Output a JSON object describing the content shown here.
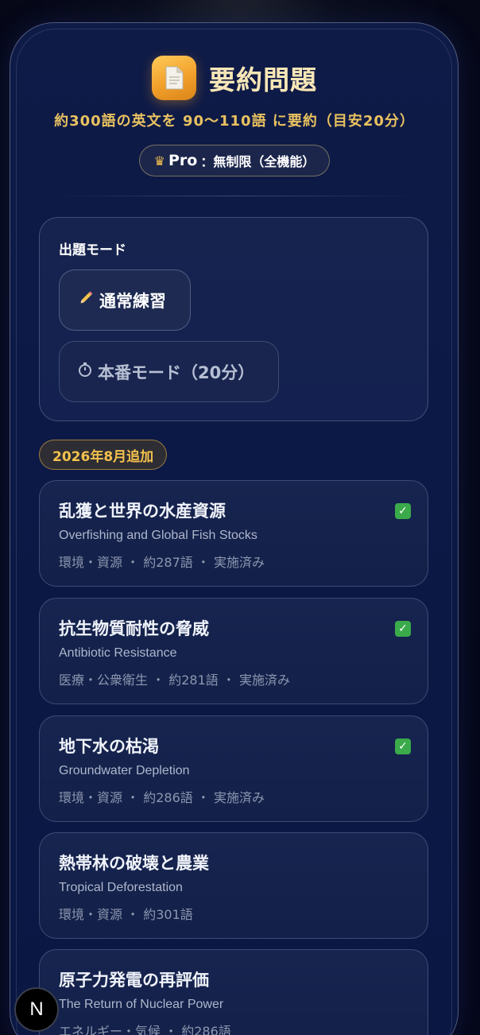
{
  "header": {
    "title": "要約問題",
    "subtitle": "約300語の英文を 90〜110語 に要約（目安20分）",
    "pro_label": "Pro",
    "pro_detail": "：無制限（全機能）"
  },
  "mode": {
    "label": "出題モード",
    "normal": "通常練習",
    "exam": "本番モード（20分）"
  },
  "added_badge": "2026年8月追加",
  "topics": [
    {
      "title": "乱獲と世界の水産資源",
      "en": "Overfishing and Global Fish Stocks",
      "category": "環境・資源",
      "words": "約287語",
      "status": "実施済み",
      "done": true
    },
    {
      "title": "抗生物質耐性の脅威",
      "en": "Antibiotic Resistance",
      "category": "医療・公衆衛生",
      "words": "約281語",
      "status": "実施済み",
      "done": true
    },
    {
      "title": "地下水の枯渇",
      "en": "Groundwater Depletion",
      "category": "環境・資源",
      "words": "約286語",
      "status": "実施済み",
      "done": true
    },
    {
      "title": "熱帯林の破壊と農業",
      "en": "Tropical Deforestation",
      "category": "環境・資源",
      "words": "約301語",
      "status": "",
      "done": false
    },
    {
      "title": "原子力発電の再評価",
      "en": "The Return of Nuclear Power",
      "category": "エネルギー・気候",
      "words": "約286語",
      "status": "",
      "done": false
    }
  ],
  "separator": "・",
  "nav_letter": "N",
  "icons": {
    "app": "document-icon",
    "crown": "crown-icon",
    "pencil": "pencil-icon",
    "timer": "stopwatch-icon",
    "check": "check-icon"
  },
  "colors": {
    "accent_gold": "#f3c24d",
    "check_green": "#3aaa4a",
    "panel_navy": "#0f1b47"
  }
}
